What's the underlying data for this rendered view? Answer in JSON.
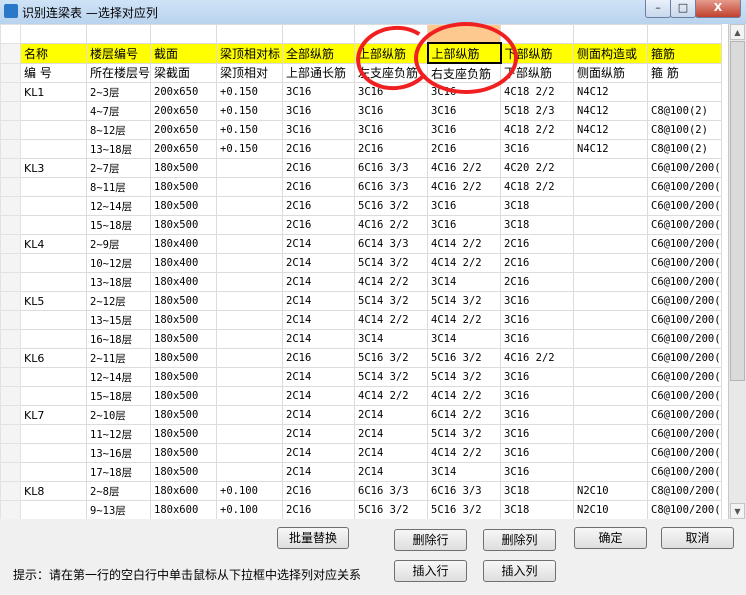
{
  "window": {
    "title": "识别连梁表 —选择对应列",
    "min_label": "–",
    "max_label": "□",
    "close_label": "X"
  },
  "header_row": [
    "名称",
    "楼层编号",
    "截面",
    "梁顶相对标",
    "全部纵筋",
    "上部纵筋",
    "上部纵筋",
    "下部纵筋",
    "侧面构造或",
    "箍筋"
  ],
  "sub_header_row": [
    "编 号",
    "所在楼层号",
    "梁截面",
    "梁顶相对",
    "上部通长筋",
    "左支座负筋",
    "右支座负筋",
    "下部纵筋",
    "侧面纵筋",
    "箍 筋"
  ],
  "rows": [
    [
      "KL1",
      "2~3层",
      "200x650",
      "+0.150",
      "3C16",
      "3C16",
      "3C16",
      "4C18 2/2",
      "N4C12",
      ""
    ],
    [
      "",
      "4~7层",
      "200x650",
      "+0.150",
      "3C16",
      "3C16",
      "3C16",
      "5C18 2/3",
      "N4C12",
      "C8@100(2)"
    ],
    [
      "",
      "8~12层",
      "200x650",
      "+0.150",
      "3C16",
      "3C16",
      "3C16",
      "4C18 2/2",
      "N4C12",
      "C8@100(2)"
    ],
    [
      "",
      "13~18层",
      "200x650",
      "+0.150",
      "2C16",
      "2C16",
      "2C16",
      "3C16",
      "N4C12",
      "C8@100(2)"
    ],
    [
      "KL3",
      "2~7层",
      "180x500",
      "",
      "2C16",
      "6C16 3/3",
      "4C16 2/2",
      "4C20 2/2",
      "",
      "C6@100/200("
    ],
    [
      "",
      "8~11层",
      "180x500",
      "",
      "2C16",
      "6C16 3/3",
      "4C16 2/2",
      "4C18 2/2",
      "",
      "C6@100/200("
    ],
    [
      "",
      "12~14层",
      "180x500",
      "",
      "2C16",
      "5C16 3/2",
      "3C16",
      "3C18",
      "",
      "C6@100/200("
    ],
    [
      "",
      "15~18层",
      "180x500",
      "",
      "2C16",
      "4C16 2/2",
      "3C16",
      "3C18",
      "",
      "C6@100/200("
    ],
    [
      "KL4",
      "2~9层",
      "180x400",
      "",
      "2C14",
      "6C14 3/3",
      "4C14 2/2",
      "2C16",
      "",
      "C6@100/200("
    ],
    [
      "",
      "10~12层",
      "180x400",
      "",
      "2C14",
      "5C14 3/2",
      "4C14 2/2",
      "2C16",
      "",
      "C6@100/200("
    ],
    [
      "",
      "13~18层",
      "180x400",
      "",
      "2C14",
      "4C14 2/2",
      "3C14",
      "2C16",
      "",
      "C6@100/200("
    ],
    [
      "KL5",
      "2~12层",
      "180x500",
      "",
      "2C14",
      "5C14 3/2",
      "5C14 3/2",
      "3C16",
      "",
      "C6@100/200("
    ],
    [
      "",
      "13~15层",
      "180x500",
      "",
      "2C14",
      "4C14 2/2",
      "4C14 2/2",
      "3C16",
      "",
      "C6@100/200("
    ],
    [
      "",
      "16~18层",
      "180x500",
      "",
      "2C14",
      "3C14",
      "3C14",
      "3C16",
      "",
      "C6@100/200("
    ],
    [
      "KL6",
      "2~11层",
      "180x500",
      "",
      "2C16",
      "5C16 3/2",
      "5C16 3/2",
      "4C16 2/2",
      "",
      "C6@100/200("
    ],
    [
      "",
      "12~14层",
      "180x500",
      "",
      "2C14",
      "5C14 3/2",
      "5C14 3/2",
      "3C16",
      "",
      "C6@100/200("
    ],
    [
      "",
      "15~18层",
      "180x500",
      "",
      "2C14",
      "4C14 2/2",
      "4C14 2/2",
      "3C16",
      "",
      "C6@100/200("
    ],
    [
      "KL7",
      "2~10层",
      "180x500",
      "",
      "2C14",
      "2C14",
      "6C14 2/2",
      "3C16",
      "",
      "C6@100/200("
    ],
    [
      "",
      "11~12层",
      "180x500",
      "",
      "2C14",
      "2C14",
      "5C14 3/2",
      "3C16",
      "",
      "C6@100/200("
    ],
    [
      "",
      "13~16层",
      "180x500",
      "",
      "2C14",
      "2C14",
      "4C14 2/2",
      "3C16",
      "",
      "C6@100/200("
    ],
    [
      "",
      "17~18层",
      "180x500",
      "",
      "2C14",
      "2C14",
      "3C14",
      "3C16",
      "",
      "C6@100/200("
    ],
    [
      "KL8",
      "2~8层",
      "180x600",
      "+0.100",
      "2C16",
      "6C16 3/3",
      "6C16 3/3",
      "3C18",
      "N2C10",
      "C8@100/200("
    ],
    [
      "",
      "9~13层",
      "180x600",
      "+0.100",
      "2C16",
      "5C16 3/2",
      "5C16 3/2",
      "3C18",
      "N2C10",
      "C8@100/200("
    ]
  ],
  "buttons": {
    "batch_replace": "批量替换",
    "delete_row": "删除行",
    "delete_col": "删除列",
    "ok": "确定",
    "cancel": "取消",
    "insert_row": "插入行",
    "insert_col": "插入列"
  },
  "hint": "提示：请在第一行的空白行中单击鼠标从下拉框中选择列对应关系",
  "colors": {
    "header_highlight": "#ffff00",
    "selected_column": "#fdc98e",
    "annotation": "#f02020"
  }
}
